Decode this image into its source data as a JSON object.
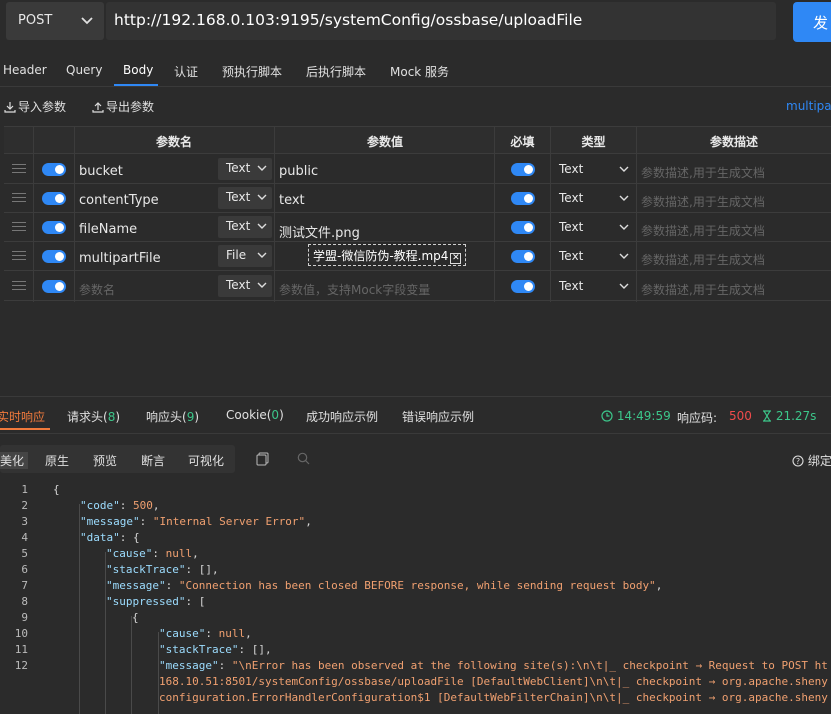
{
  "request": {
    "method": "POST",
    "url": "http://192.168.0.103:9195/systemConfig/ossbase/uploadFile",
    "send_label": "发"
  },
  "tabs": [
    "Header",
    "Query",
    "Body",
    "认证",
    "预执行脚本",
    "后执行脚本",
    "Mock 服务"
  ],
  "active_tab": "Body",
  "body_toolbar": {
    "import_label": "导入参数",
    "export_label": "导出参数",
    "content_type": "multipart"
  },
  "table": {
    "headers": [
      "参数名",
      "参数值",
      "必填",
      "类型",
      "参数描述"
    ],
    "rows": [
      {
        "name": "bucket",
        "type": "Text",
        "value": "public",
        "required": true,
        "value_type": "Text",
        "desc": "参数描述,用于生成文档"
      },
      {
        "name": "contentType",
        "type": "Text",
        "value": "text",
        "required": true,
        "value_type": "Text",
        "desc": "参数描述,用于生成文档"
      },
      {
        "name": "fileName",
        "type": "Text",
        "value": "测试文件.png",
        "required": true,
        "value_type": "Text",
        "desc": "参数描述,用于生成文档"
      },
      {
        "name": "multipartFile",
        "type": "File",
        "value": "学盟-微信防伪-教程.mp4",
        "required": true,
        "value_type": "Text",
        "desc": "参数描述,用于生成文档"
      }
    ],
    "empty_row": {
      "name_placeholder": "参数名",
      "type": "Text",
      "value_placeholder": "参数值，支持Mock字段变量",
      "value_type": "Text",
      "desc_placeholder": "参数描述,用于生成文档"
    }
  },
  "response": {
    "tabs": [
      {
        "label": "实时响应",
        "count": ""
      },
      {
        "label": "请求头",
        "count": "8"
      },
      {
        "label": "响应头",
        "count": "9"
      },
      {
        "label": "Cookie",
        "count": "0"
      },
      {
        "label": "成功响应示例",
        "count": ""
      },
      {
        "label": "错误响应示例",
        "count": ""
      }
    ],
    "time": "14:49:59",
    "status_label": "响应码:",
    "status_code": "500",
    "duration": "21.27s",
    "view_tabs": [
      "美化",
      "原生",
      "预览",
      "断言",
      "可视化"
    ],
    "bind_label": "绑定"
  },
  "body_lines": [
    "{",
    "\"code\": 500,",
    "\"message\": \"Internal Server Error\",",
    "\"data\": {",
    "\"cause\": null,",
    "\"stackTrace\": [],",
    "\"message\": \"Connection has been closed BEFORE response, while sending request body\",",
    "\"suppressed\": [",
    "{",
    "\"cause\": null,",
    "\"stackTrace\": [],",
    "\"message\": \"\\nError has been observed at the following site(s):\\n\\t|_ checkpoint → Request to POST ht",
    "168.10.51:8501/systemConfig/ossbase/uploadFile [DefaultWebClient]\\n\\t|_ checkpoint → org.apache.sheny",
    "configuration.ErrorHandlerConfiguration$1 [DefaultWebFilterChain]\\n\\t|_ checkpoint → org.apache.sheny"
  ],
  "line_numbers": [
    "1",
    "2",
    "3",
    "4",
    "5",
    "6",
    "7",
    "8",
    "9",
    "10",
    "11",
    "12"
  ],
  "colors": {
    "accent": "#2f88f5",
    "success": "#3cc68a",
    "error": "#f04b4b",
    "orange": "#f07a3c"
  }
}
